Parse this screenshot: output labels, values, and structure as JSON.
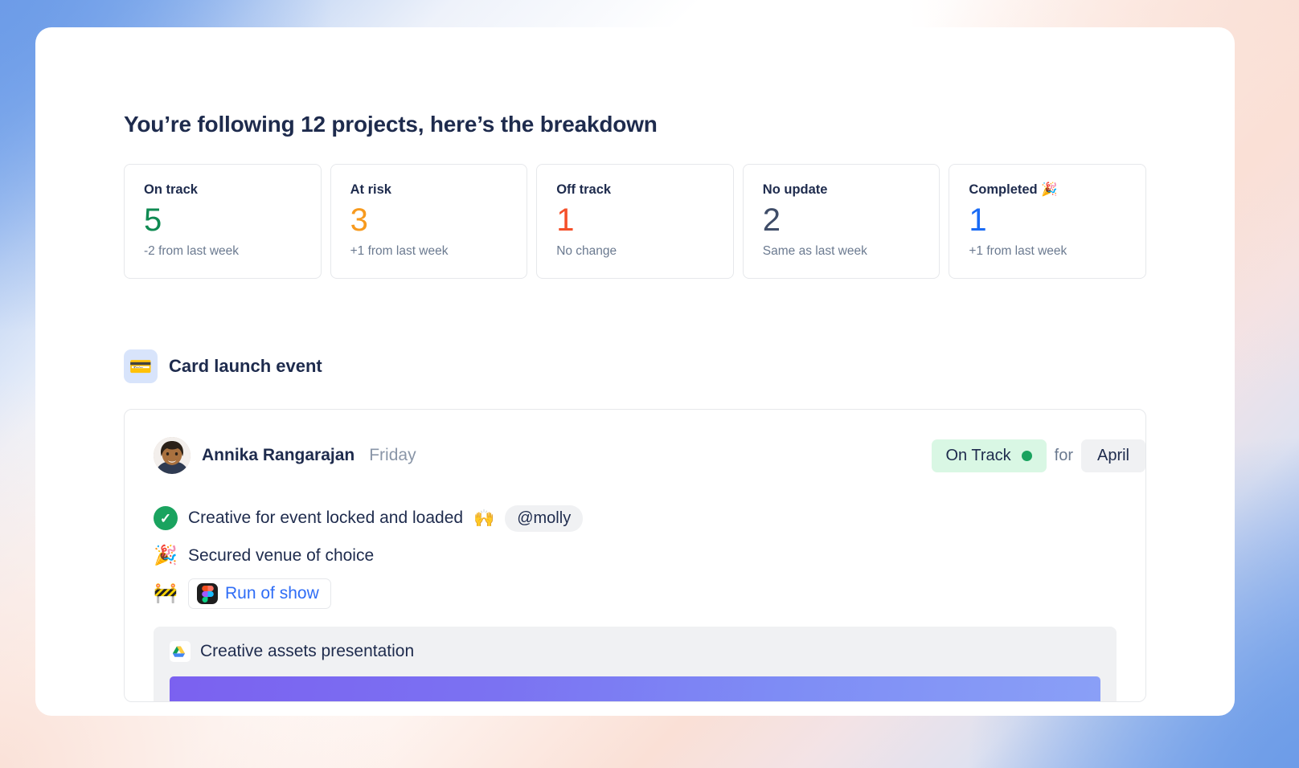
{
  "page": {
    "title": "You’re following 12 projects, here’s the breakdown"
  },
  "stats": [
    {
      "label": "On track",
      "value": "5",
      "delta": "-2 from last week",
      "color": "#0f8a52"
    },
    {
      "label": "At risk",
      "value": "3",
      "delta": "+1 from last week",
      "color": "#f79a1e"
    },
    {
      "label": "Off track",
      "value": "1",
      "delta": "No change",
      "color": "#f4502a"
    },
    {
      "label": "No update",
      "value": "2",
      "delta": "Same as last week",
      "color": "#3f4d68"
    },
    {
      "label": "Completed 🎉",
      "value": "1",
      "delta": "+1 from last week",
      "color": "#1a6bf5"
    }
  ],
  "project": {
    "emoji": "💳",
    "name": "Card launch event"
  },
  "update": {
    "author": "Annika Rangarajan",
    "day": "Friday",
    "status_label": "On Track",
    "status_color": "#1aa35f",
    "for_label": "for",
    "month": "April",
    "bullets": [
      {
        "icon": "check-circle-icon",
        "glyph": "✓",
        "text": "Creative for event locked and loaded",
        "trailing_emoji": "🙌",
        "mention": "@molly"
      },
      {
        "icon": "party-popper-emoji",
        "glyph": "🎉",
        "text": "Secured venue of choice",
        "trailing_emoji": "",
        "mention": ""
      },
      {
        "icon": "construction-emoji",
        "glyph": "🚧",
        "text": "",
        "link_text": "Run of show",
        "link_badge": "figma-icon"
      }
    ],
    "attachment": {
      "badge": "google-drive-icon",
      "title": "Creative assets presentation"
    }
  }
}
